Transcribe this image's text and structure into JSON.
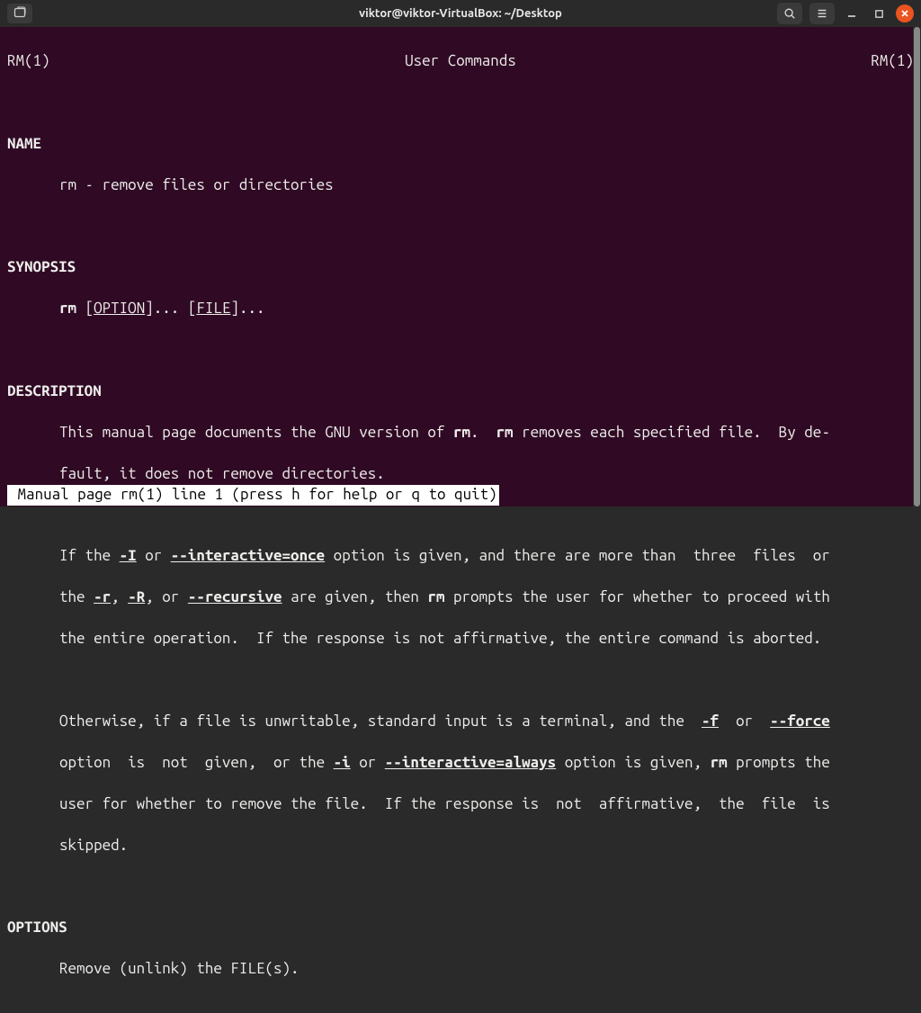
{
  "window": {
    "title": "viktor@viktor-VirtualBox: ~/Desktop"
  },
  "header": {
    "left": "RM(1)",
    "center": "User Commands",
    "right": "RM(1)"
  },
  "sections": {
    "name_heading": "NAME",
    "name_line": "rm - remove files or directories",
    "synopsis_heading": "SYNOPSIS",
    "synopsis_cmd": "rm",
    "synopsis_lb1": " [",
    "synopsis_option": "OPTION",
    "synopsis_mid": "]... [",
    "synopsis_file": "FILE",
    "synopsis_end": "]...",
    "description_heading": "DESCRIPTION",
    "desc_p1_a": "This manual page documents the GNU version of ",
    "desc_p1_rm1": "rm",
    "desc_p1_b": ".  ",
    "desc_p1_rm2": "rm",
    "desc_p1_c": " removes each specified file.  By de‐",
    "desc_p1_d": "fault, it does not remove directories.",
    "desc_p2_a": "If the ",
    "desc_p2_I": "-I",
    "desc_p2_b": " or ",
    "desc_p2_once": "--interactive=once",
    "desc_p2_c": " option is given, and there are more than  three  files  or",
    "desc_p2_d": "the ",
    "desc_p2_r": "-r",
    "desc_p2_e": ", ",
    "desc_p2_R": "-R",
    "desc_p2_f": ", or ",
    "desc_p2_rec": "--recursive",
    "desc_p2_g": " are given, then ",
    "desc_p2_rm": "rm",
    "desc_p2_h": " prompts the user for whether to proceed with",
    "desc_p2_i": "the entire operation.  If the response is not affirmative, the entire command is aborted.",
    "desc_p3_a": "Otherwise, if a file is unwritable, standard input is a terminal, and the  ",
    "desc_p3_foptflag": "-f",
    "desc_p3_b": "  or  ",
    "desc_p3_force": "--force",
    "desc_p3_c": "option  is  not  given,  or the ",
    "desc_p3_iopt": "-i",
    "desc_p3_d": " or ",
    "desc_p3_always": "--interactive=always",
    "desc_p3_e": " option is given, ",
    "desc_p3_rm": "rm",
    "desc_p3_f": " prompts the",
    "desc_p3_g": "user for whether to remove the file.  If the response is  not  affirmative,  the  file  is",
    "desc_p3_h": "skipped.",
    "options_heading": "OPTIONS",
    "options_line": "Remove (unlink) the FILE(s)."
  },
  "statusbar": " Manual page rm(1) line 1 (press h for help or q to quit)"
}
